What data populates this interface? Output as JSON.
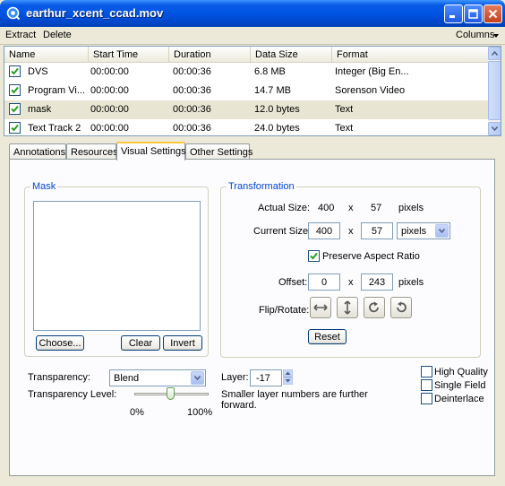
{
  "window": {
    "title": "earthur_xcent_ccad.mov"
  },
  "menu": {
    "extract": "Extract",
    "delete": "Delete",
    "columns": "Columns"
  },
  "table": {
    "headers": [
      "Name",
      "Start Time",
      "Duration",
      "Data Size",
      "Format"
    ],
    "rows": [
      {
        "name": "DVS",
        "start": "00:00:00",
        "duration": "00:00:36",
        "size": "6.8 MB",
        "format": "Integer (Big En..."
      },
      {
        "name": "Program Vi...",
        "start": "00:00:00",
        "duration": "00:00:36",
        "size": "14.7 MB",
        "format": "Sorenson Video"
      },
      {
        "name": "mask",
        "start": "00:00:00",
        "duration": "00:00:36",
        "size": "12.0 bytes",
        "format": "Text"
      },
      {
        "name": "Text Track 2",
        "start": "00:00:00",
        "duration": "00:00:36",
        "size": "24.0 bytes",
        "format": "Text"
      }
    ]
  },
  "tabs": {
    "annotations": "Annotations",
    "resources": "Resources",
    "visual": "Visual Settings",
    "other": "Other Settings"
  },
  "mask": {
    "title": "Mask",
    "choose": "Choose...",
    "clear": "Clear",
    "invert": "Invert"
  },
  "transform": {
    "title": "Transformation",
    "actual_label": "Actual Size:",
    "actual_w": "400",
    "x1": "x",
    "actual_h": "57",
    "actual_unit": "pixels",
    "current_label": "Current Size:",
    "current_w": "400",
    "x2": "x",
    "current_h": "57",
    "current_unit": "pixels",
    "aspect": "Preserve Aspect Ratio",
    "offset_label": "Offset:",
    "offset_x": "0",
    "x3": "x",
    "offset_y": "243",
    "offset_unit": "pixels",
    "flip_label": "Flip/Rotate:",
    "reset": "Reset"
  },
  "transparency": {
    "label": "Transparency:",
    "mode": "Blend",
    "level_label": "Transparency Level:",
    "min": "0%",
    "max": "100%",
    "level_percent": 48
  },
  "layer": {
    "label": "Layer:",
    "value": "-17",
    "note": "Smaller layer numbers are further forward."
  },
  "options": {
    "high_quality": "High Quality",
    "single_field": "Single Field",
    "deinterlace": "Deinterlace"
  },
  "colors": {
    "titlebar": "#0054e3",
    "legend": "#0046d5",
    "tab_highlight": "#ffc83c",
    "check": "#21a121"
  }
}
